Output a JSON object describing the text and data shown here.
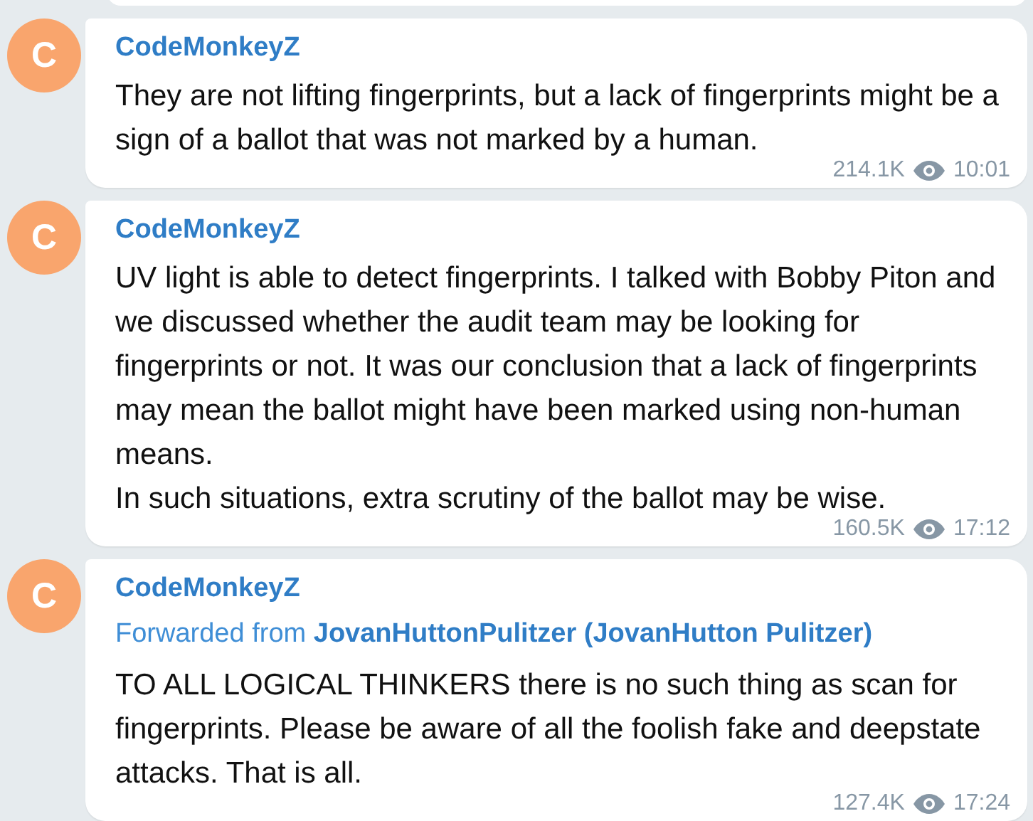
{
  "messages": [
    {
      "avatar": "C",
      "author": "CodeMonkeyZ",
      "text": "They are not lifting fingerprints, but a lack of fingerprints might be a sign of a ballot that was not marked by a human.",
      "views": "214.1K",
      "time": "10:01"
    },
    {
      "avatar": "C",
      "author": "CodeMonkeyZ",
      "text": "UV light is able to detect fingerprints. I talked with Bobby Piton and we discussed whether the audit team may be looking for fingerprints or not. It was our conclusion that a lack of fingerprints may mean the ballot might have been marked using non-human means.\nIn such situations, extra scrutiny of the ballot may be wise.",
      "views": "160.5K",
      "time": "17:12"
    },
    {
      "avatar": "C",
      "author": "CodeMonkeyZ",
      "forwarded": "Forwarded from **JovanHuttonPulitzer (JovanHutton Pulitzer)**",
      "text": "TO ALL LOGICAL THINKERS there is no such thing as scan for fingerprints. Please be aware of all the foolish fake and deepstate attacks. That is all.",
      "views": "127.4K",
      "time": "17:24"
    }
  ]
}
